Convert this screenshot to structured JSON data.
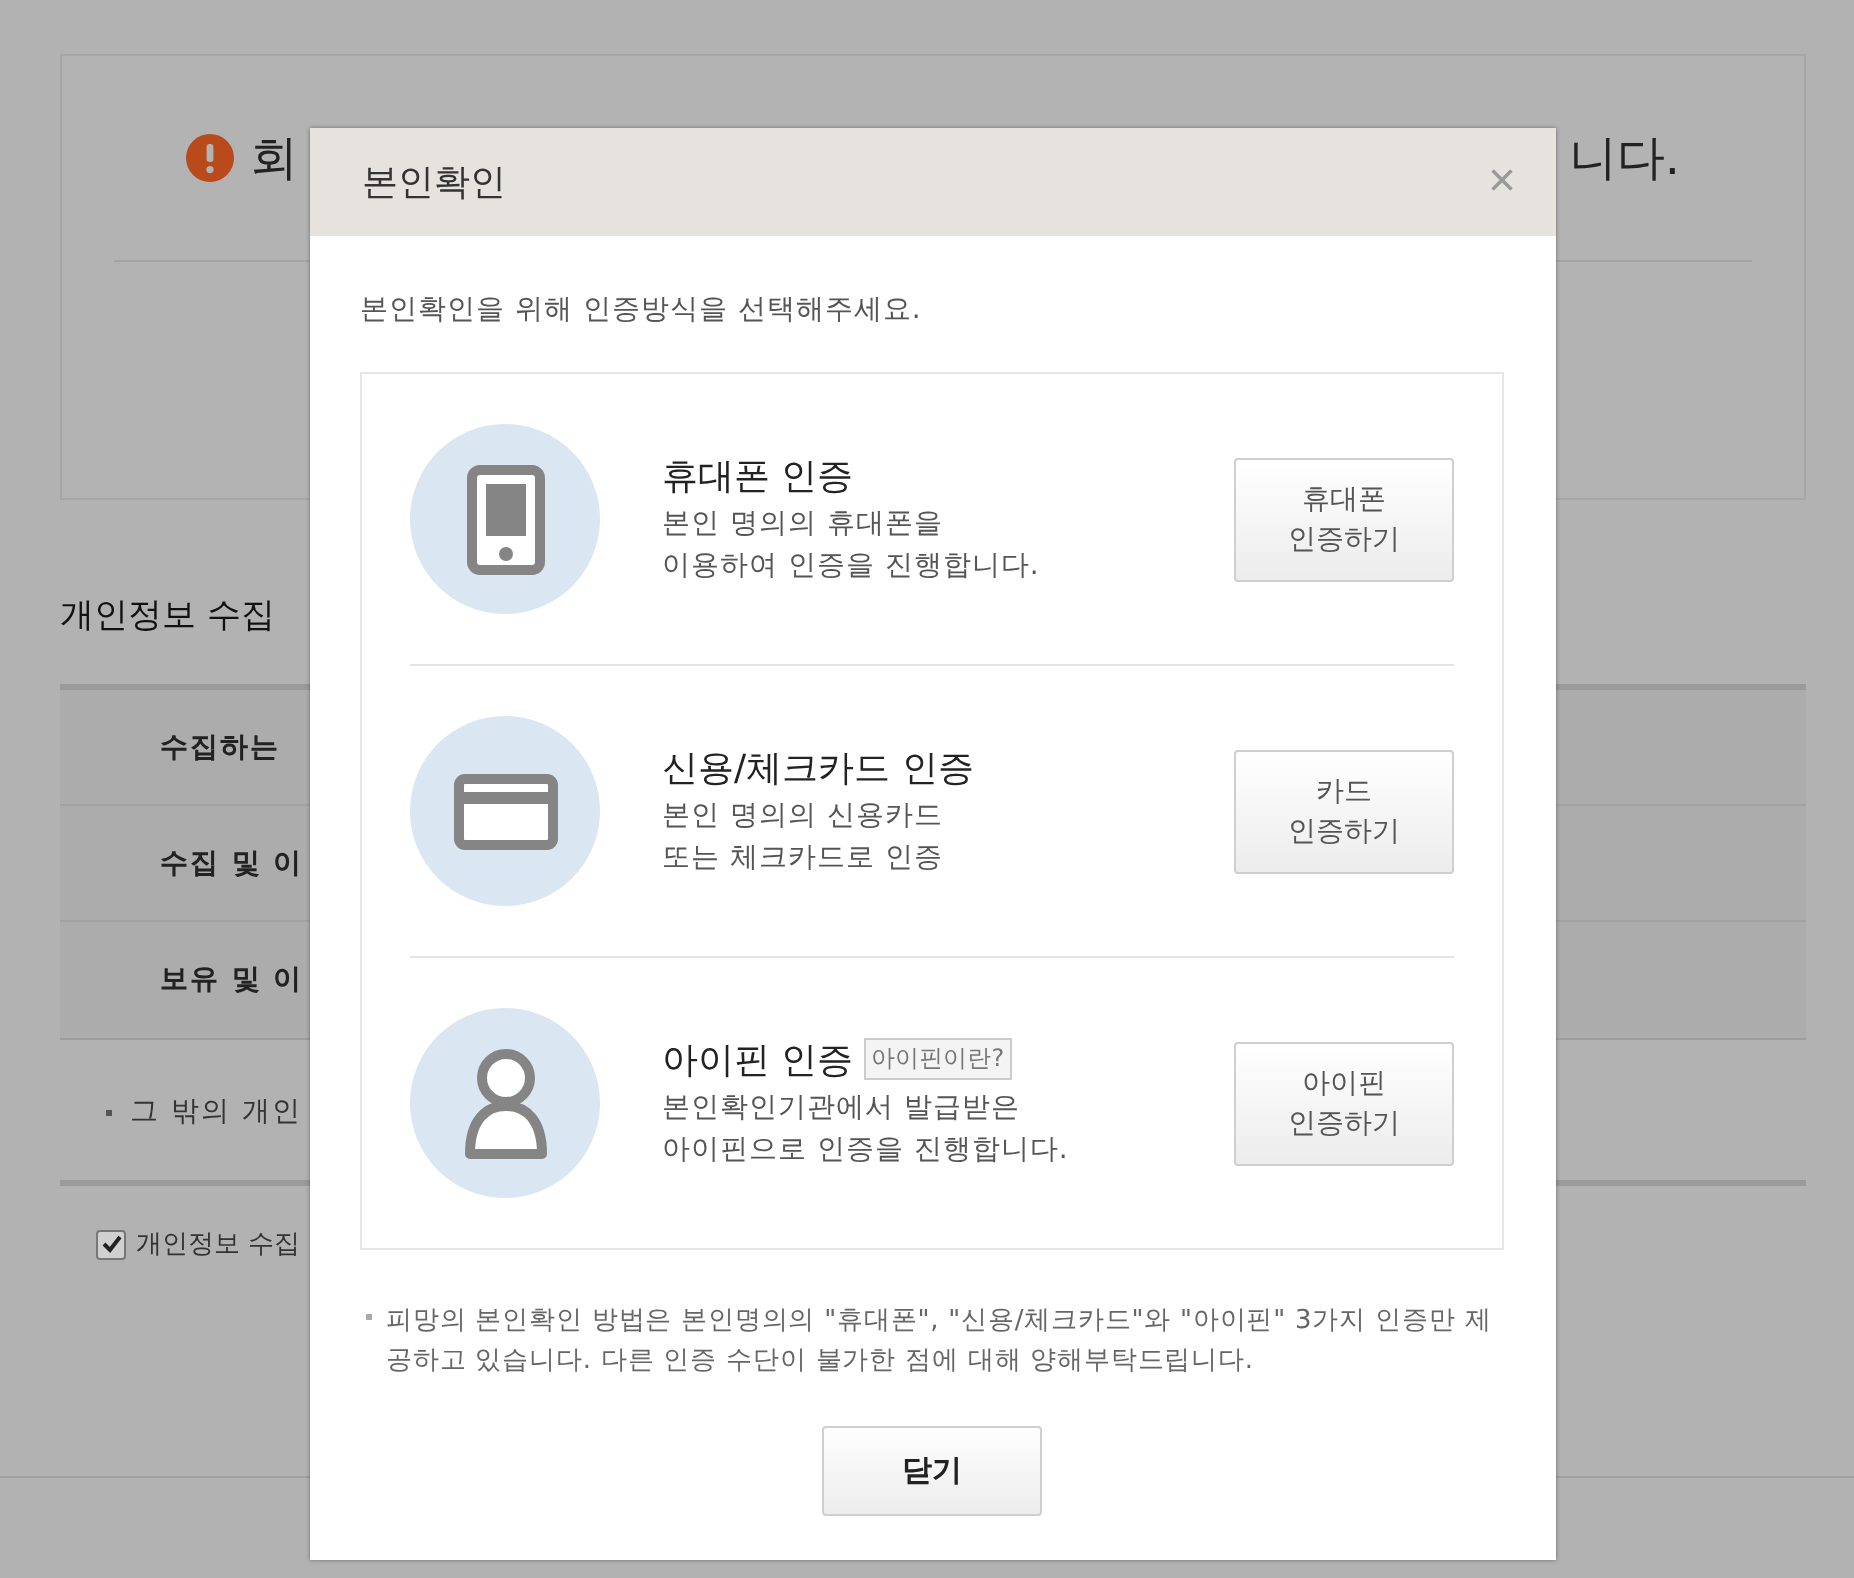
{
  "background_page": {
    "notice": {
      "text_left": "회",
      "text_right": "니다."
    },
    "section_title": "개인정보 수집",
    "table_rows": [
      "수집하는",
      "수집 및 이",
      "보유 및 이"
    ],
    "bullet_note": "그 밖의 개인",
    "agree_checkbox": {
      "label": "개인정보 수집",
      "checked": true
    }
  },
  "dialog": {
    "title": "본인확인",
    "close": "×",
    "intro": "본인확인을 위해 인증방식을 선택해주세요.",
    "options": [
      {
        "kind": "phone",
        "title": "휴대폰 인증",
        "description": [
          "본인 명의의 휴대폰을",
          "이용하여 인증을 진행합니다."
        ],
        "button": [
          "휴대폰",
          "인증하기"
        ]
      },
      {
        "kind": "card",
        "title": "신용/체크카드 인증",
        "description": [
          "본인 명의의 신용카드",
          "또는 체크카드로 인증"
        ],
        "button": [
          "카드",
          "인증하기"
        ]
      },
      {
        "kind": "ipin",
        "title": "아이핀 인증",
        "badge": "아이핀이란?",
        "description": [
          "본인확인기관에서 발급받은",
          "아이핀으로 인증을 진행합니다."
        ],
        "button": [
          "아이핀",
          "인증하기"
        ]
      }
    ],
    "note": "피망의 본인확인 방법은 본인명의의 \"휴대폰\", \"신용/체크카드\"와 \"아이핀\" 3가지 인증만 제공하고 있습니다. 다른 인증 수단이 불가한 점에 대해 양해부탁드립니다.",
    "close_button": "닫기"
  }
}
